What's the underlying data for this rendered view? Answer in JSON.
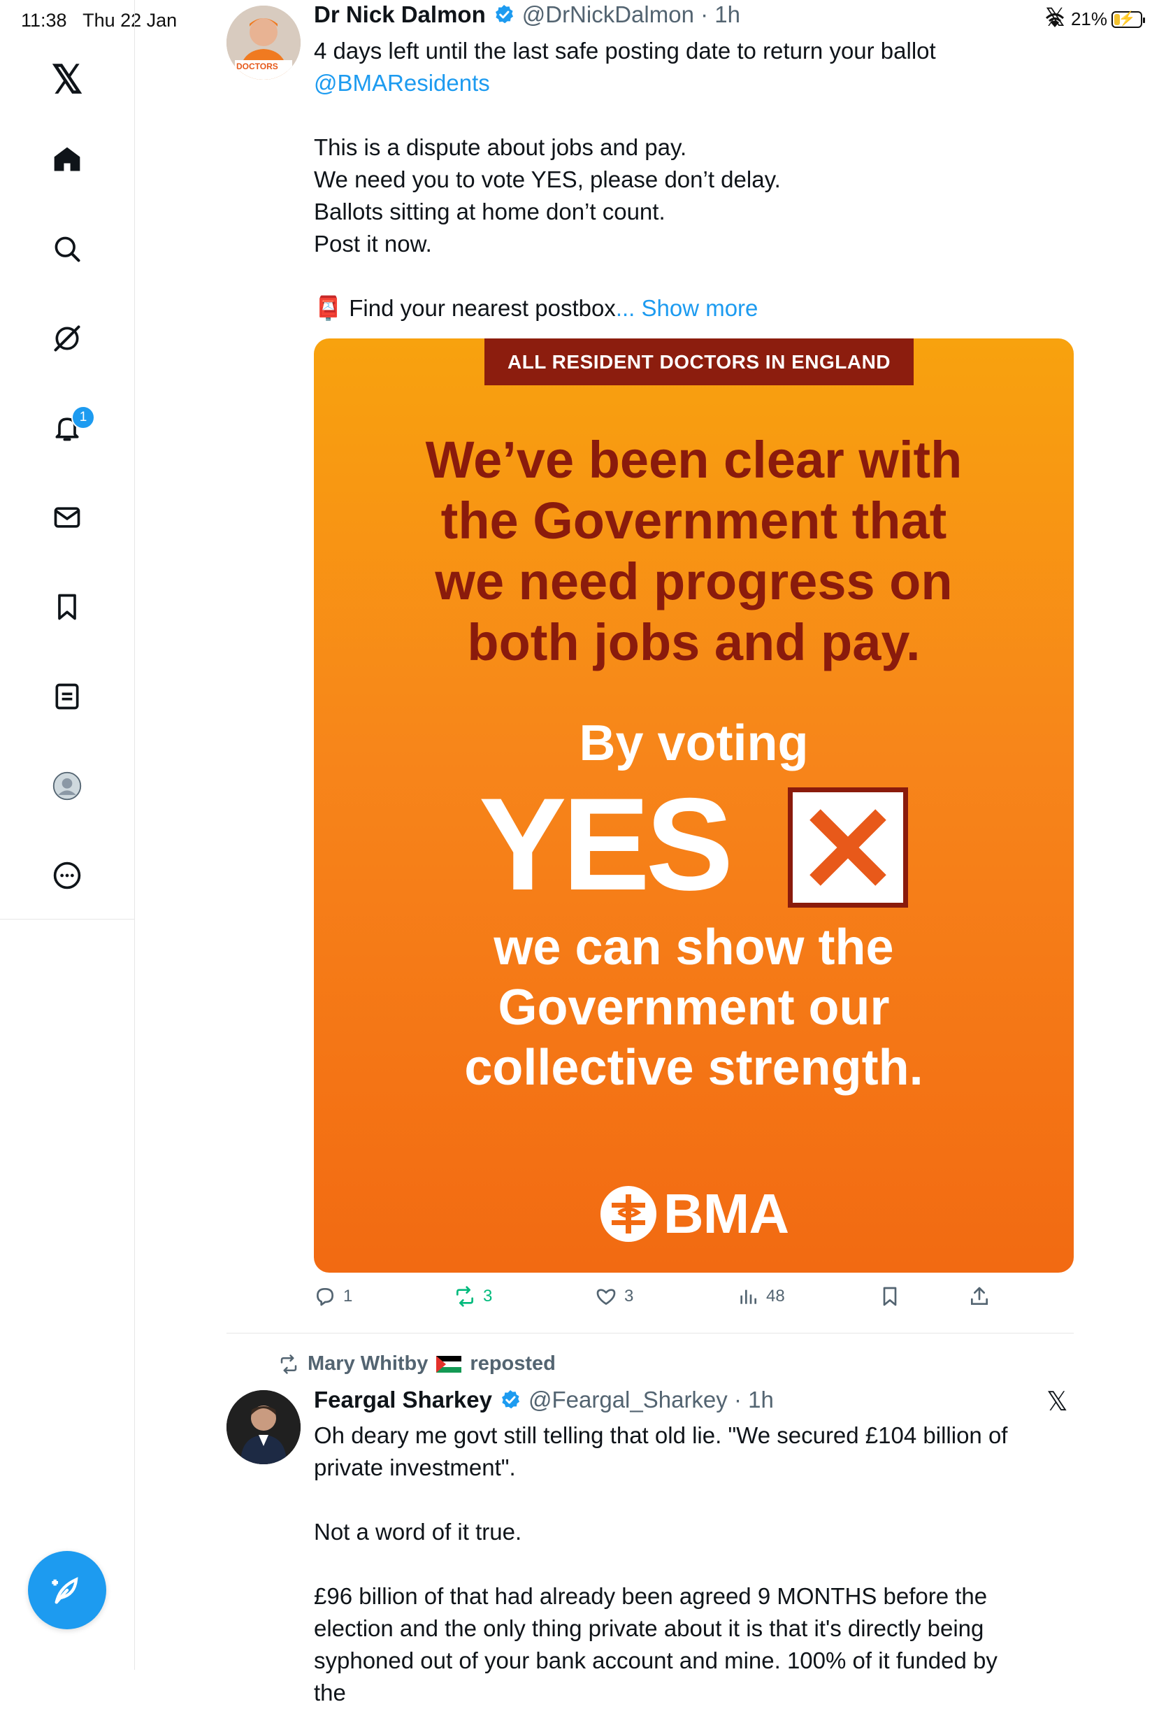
{
  "status_bar": {
    "time": "11:38",
    "date": "Thu 22 Jan",
    "battery_text": "21%",
    "x_logo": "𝕏"
  },
  "sidebar": {
    "logo": "𝕏",
    "items": [
      {
        "name": "home",
        "icon": "home-icon"
      },
      {
        "name": "explore",
        "icon": "search-icon"
      },
      {
        "name": "grok",
        "icon": "grok-icon"
      },
      {
        "name": "notifications",
        "icon": "bell-icon",
        "badge": "1"
      },
      {
        "name": "messages",
        "icon": "envelope-icon"
      },
      {
        "name": "bookmarks",
        "icon": "bookmark-icon"
      },
      {
        "name": "lists",
        "icon": "list-icon"
      },
      {
        "name": "profile",
        "icon": "avatar-icon"
      },
      {
        "name": "more",
        "icon": "more-circle-icon"
      }
    ],
    "accent_color": "#1d9bf0"
  },
  "tweet1": {
    "author_name": "Dr Nick Dalmon",
    "handle_time": "@DrNickDalmon · 1h",
    "line1": "4 days left until the last safe posting date to return your ballot",
    "mention": "@BMAResidents",
    "para1": "This is a dispute about jobs and pay.",
    "para2": "We need you to vote YES, please don’t delay.",
    "para3": "Ballots sitting at home don’t count.",
    "para4": "Post it now.",
    "postbox_emoji": "📮",
    "postbox_text": "Find your nearest postbox",
    "ellipsis": "...",
    "show_more": "Show more",
    "avatar_text": "DOCTORS",
    "poster": {
      "banner": "ALL RESIDENT DOCTORS IN ENGLAND",
      "headline1": "We’ve been clear with",
      "headline2": "the Government that",
      "headline3": "we need progress on",
      "headline4": "both jobs and pay.",
      "voting": "By voting",
      "yes": "YES",
      "bottom1": "we can show the",
      "bottom2": "Government our",
      "bottom3": "collective strength.",
      "logo": "BMA",
      "colors": {
        "orange": "#f7851a",
        "dark_red": "#8a1b0c",
        "cross": "#e8591a"
      }
    },
    "actions": {
      "replies": "1",
      "reposts": "3",
      "likes": "3",
      "views": "48"
    }
  },
  "repost_notice": {
    "text_name": "Mary Whitby",
    "text_suffix": "reposted"
  },
  "tweet2": {
    "author_name": "Feargal Sharkey",
    "handle_time": "@Feargal_Sharkey · 1h",
    "line1": "Oh deary me govt still telling that old lie. \"We secured £104 billion of private investment\".",
    "para1": "Not a word of it true.",
    "para2": "£96 billion of that had already been agreed 9 MONTHS before the election and the only thing private about it is that it's directly being syphoned out of your bank account and mine. 100% of it funded by the"
  }
}
